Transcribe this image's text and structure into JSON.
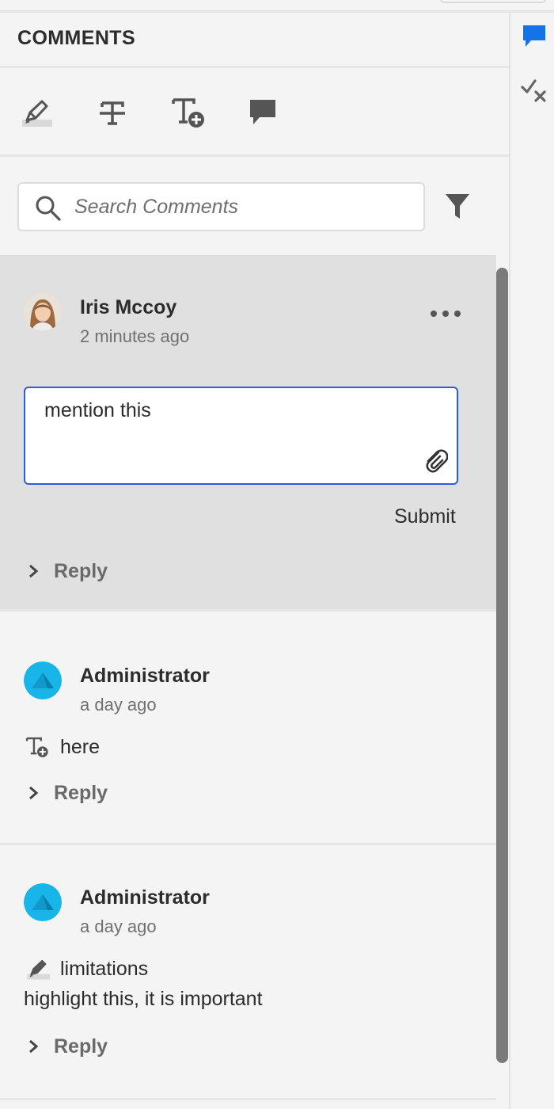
{
  "panel": {
    "title": "COMMENTS"
  },
  "toolbar": {
    "tools": [
      {
        "icon": "highlight-icon"
      },
      {
        "icon": "strikethrough-icon"
      },
      {
        "icon": "insert-text-icon"
      },
      {
        "icon": "sticky-note-icon"
      }
    ]
  },
  "search": {
    "placeholder": "Search Comments",
    "value": ""
  },
  "rail": {
    "items": [
      {
        "icon": "comment-icon",
        "active": true,
        "color": "#1473e6"
      },
      {
        "icon": "review-checkmark-icon",
        "active": false
      }
    ]
  },
  "comments": [
    {
      "author": "Iris Mccoy",
      "time": "2 minutes ago",
      "editor_text": "mention this",
      "submit_label": "Submit",
      "reply_label": "Reply",
      "active": true
    },
    {
      "author": "Administrator",
      "time": "a day ago",
      "annotation_icon": "insert-text-icon",
      "annotation_text": "here",
      "reply_label": "Reply"
    },
    {
      "author": "Administrator",
      "time": "a day ago",
      "annotation_icon": "highlight-icon",
      "annotation_text": "limitations",
      "body": "highlight this, it is important",
      "reply_label": "Reply"
    }
  ],
  "colors": {
    "accent": "#1473e6",
    "editor_border": "#2a5fd6",
    "admin_avatar": "#18b6e8",
    "active_comment_bg": "#e0e0e0"
  }
}
